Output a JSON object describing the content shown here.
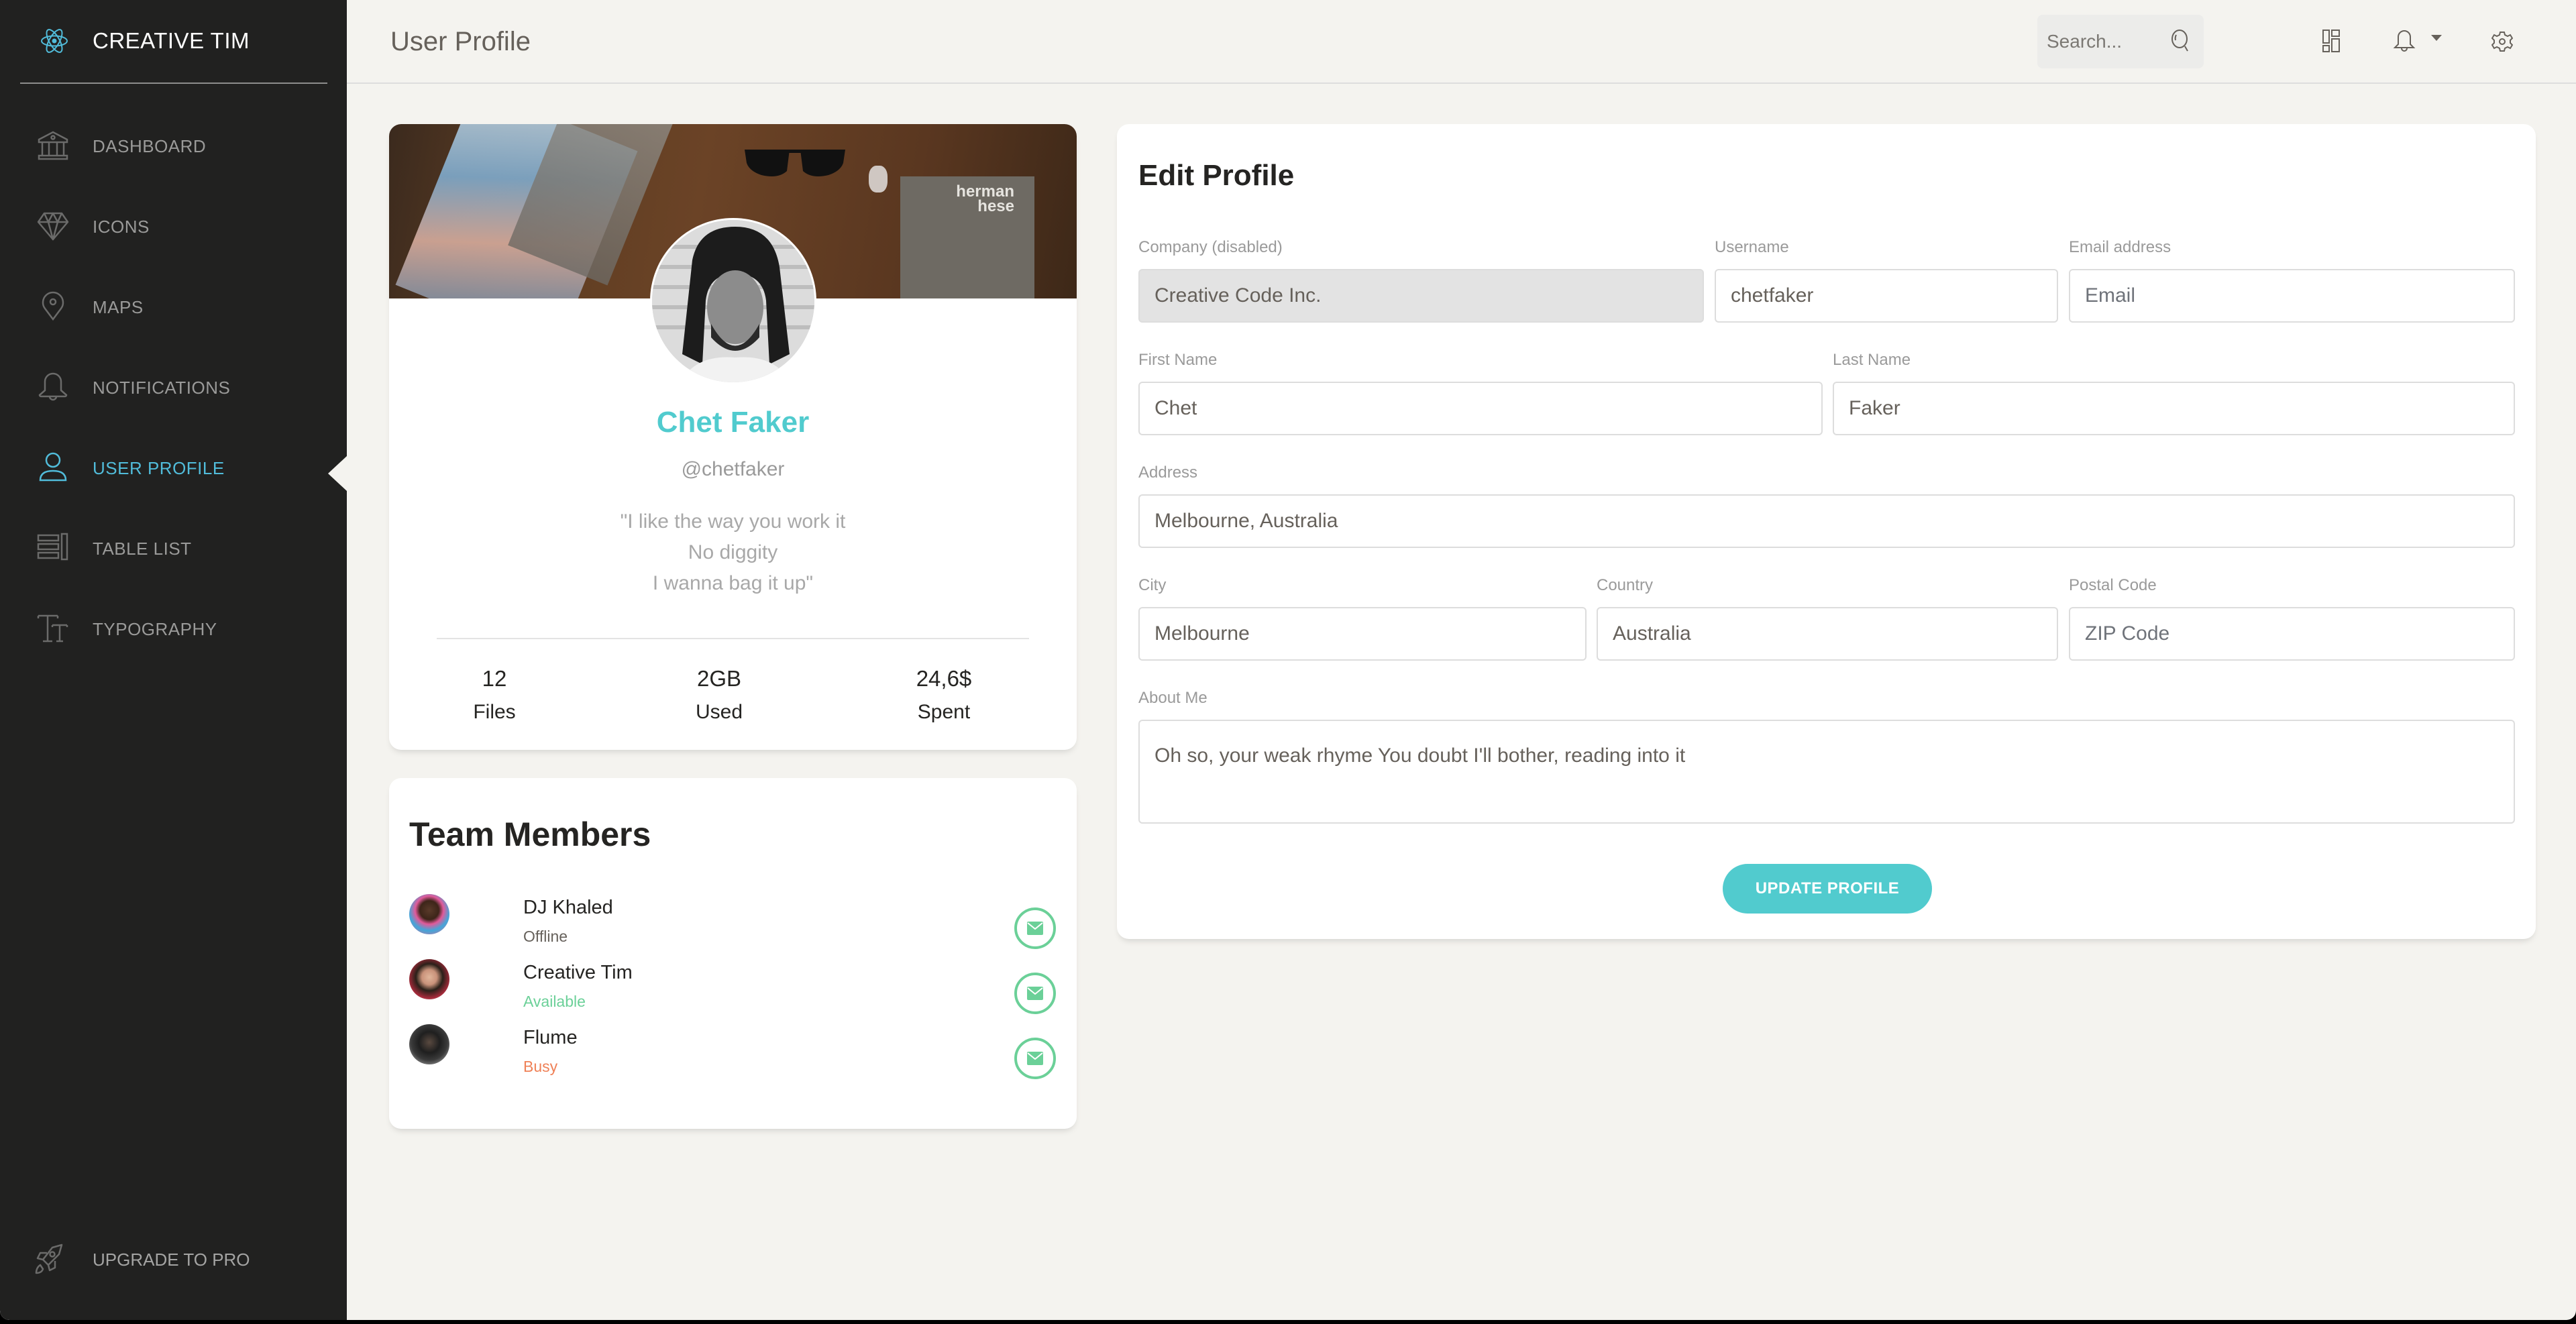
{
  "brand": {
    "name": "CREATIVE TIM",
    "icon": "react-atom-icon",
    "accent": "#51bcda"
  },
  "sidebar": {
    "items": [
      {
        "label": "DASHBOARD",
        "icon": "bank-icon",
        "active": false
      },
      {
        "label": "ICONS",
        "icon": "diamond-icon",
        "active": false
      },
      {
        "label": "MAPS",
        "icon": "map-pin-icon",
        "active": false
      },
      {
        "label": "NOTIFICATIONS",
        "icon": "bell-icon",
        "active": false
      },
      {
        "label": "USER PROFILE",
        "icon": "user-icon",
        "active": true
      },
      {
        "label": "TABLE LIST",
        "icon": "table-list-icon",
        "active": false
      },
      {
        "label": "TYPOGRAPHY",
        "icon": "typography-icon",
        "active": false
      }
    ],
    "upgrade": {
      "label": "UPGRADE TO PRO",
      "icon": "rocket-icon"
    }
  },
  "header": {
    "title": "User Profile",
    "search_placeholder": "Search...",
    "icons": [
      "search-icon",
      "dashboard-grid-icon",
      "bell-icon",
      "caret-down-icon",
      "gear-icon"
    ]
  },
  "profile": {
    "name": "Chet Faker",
    "handle": "@chetfaker",
    "quote_lines": [
      "\"I like the way you work it",
      "No diggity",
      "I wanna bag it up\""
    ],
    "cover_book_title": "herman hese",
    "stats": [
      {
        "value": "12",
        "label": "Files"
      },
      {
        "value": "2GB",
        "label": "Used"
      },
      {
        "value": "24,6$",
        "label": "Spent"
      }
    ],
    "name_color": "#51cbce"
  },
  "team": {
    "title": "Team Members",
    "members": [
      {
        "name": "DJ Khaled",
        "status": "Offline",
        "status_color": "#66615b"
      },
      {
        "name": "Creative Tim",
        "status": "Available",
        "status_color": "#6bd098"
      },
      {
        "name": "Flume",
        "status": "Busy",
        "status_color": "#ef8157"
      }
    ],
    "action_color": "#6bd098"
  },
  "edit_profile": {
    "title": "Edit Profile",
    "fields": {
      "company": {
        "label": "Company (disabled)",
        "value": "Creative Code Inc.",
        "placeholder": "Company",
        "disabled": true
      },
      "username": {
        "label": "Username",
        "value": "chetfaker",
        "placeholder": "Username"
      },
      "email": {
        "label": "Email address",
        "value": "",
        "placeholder": "Email"
      },
      "first_name": {
        "label": "First Name",
        "value": "Chet",
        "placeholder": "Company"
      },
      "last_name": {
        "label": "Last Name",
        "value": "Faker",
        "placeholder": "Last Name"
      },
      "address": {
        "label": "Address",
        "value": "Melbourne, Australia",
        "placeholder": "Home Address"
      },
      "city": {
        "label": "City",
        "value": "Melbourne",
        "placeholder": "City"
      },
      "country": {
        "label": "Country",
        "value": "Australia",
        "placeholder": "Country"
      },
      "postal_code": {
        "label": "Postal Code",
        "value": "",
        "placeholder": "ZIP Code"
      },
      "about": {
        "label": "About Me",
        "value": "Oh so, your weak rhyme You doubt I'll bother, reading into it"
      }
    },
    "submit_label": "UPDATE PROFILE",
    "submit_color": "#51cbce"
  }
}
